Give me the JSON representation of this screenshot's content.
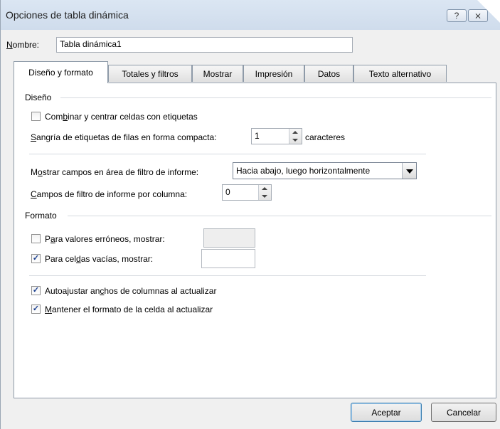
{
  "window": {
    "title": "Opciones de tabla dinámica",
    "help_glyph": "?",
    "close_glyph": "⨯"
  },
  "name_field": {
    "label_u": "N",
    "label_rest": "ombre:",
    "value": "Tabla dinámica1"
  },
  "tabs": [
    {
      "label": "Diseño y formato",
      "active": true
    },
    {
      "label": "Totales y filtros",
      "active": false
    },
    {
      "label": "Mostrar",
      "active": false
    },
    {
      "label": "Impresión",
      "active": false
    },
    {
      "label": "Datos",
      "active": false
    },
    {
      "label": "Texto alternativo",
      "active": false
    }
  ],
  "layout_section": {
    "heading": "Diseño",
    "merge_cells": {
      "pre": "Com",
      "u": "b",
      "post": "inar y centrar celdas con etiquetas",
      "checked": false
    },
    "indent": {
      "u": "S",
      "post": "angría de etiquetas de filas en forma compacta:",
      "value": "1",
      "suffix": "caracteres"
    },
    "filter_area": {
      "pre": "M",
      "u": "o",
      "post": "strar campos en área de filtro de informe:",
      "value": "Hacia abajo, luego horizontalmente"
    },
    "filter_per_column": {
      "u": "C",
      "post": "ampos de filtro de informe por columna:",
      "value": "0"
    }
  },
  "format_section": {
    "heading": "Formato",
    "error_values": {
      "pre": "P",
      "u": "a",
      "post": "ra valores erróneos, mostrar:",
      "checked": false,
      "value": ""
    },
    "empty_cells": {
      "pre": "Para cel",
      "u": "d",
      "post": "as vacías, mostrar:",
      "checked": true,
      "value": ""
    },
    "autofit": {
      "pre": "Autoajustar an",
      "u": "c",
      "post": "hos de columnas al actualizar",
      "checked": true
    },
    "preserve_format": {
      "u": "M",
      "post": "antener el formato de la celda al actualizar",
      "checked": true
    }
  },
  "buttons": {
    "ok": "Aceptar",
    "cancel": "Cancelar"
  },
  "check_glyph": "✓"
}
